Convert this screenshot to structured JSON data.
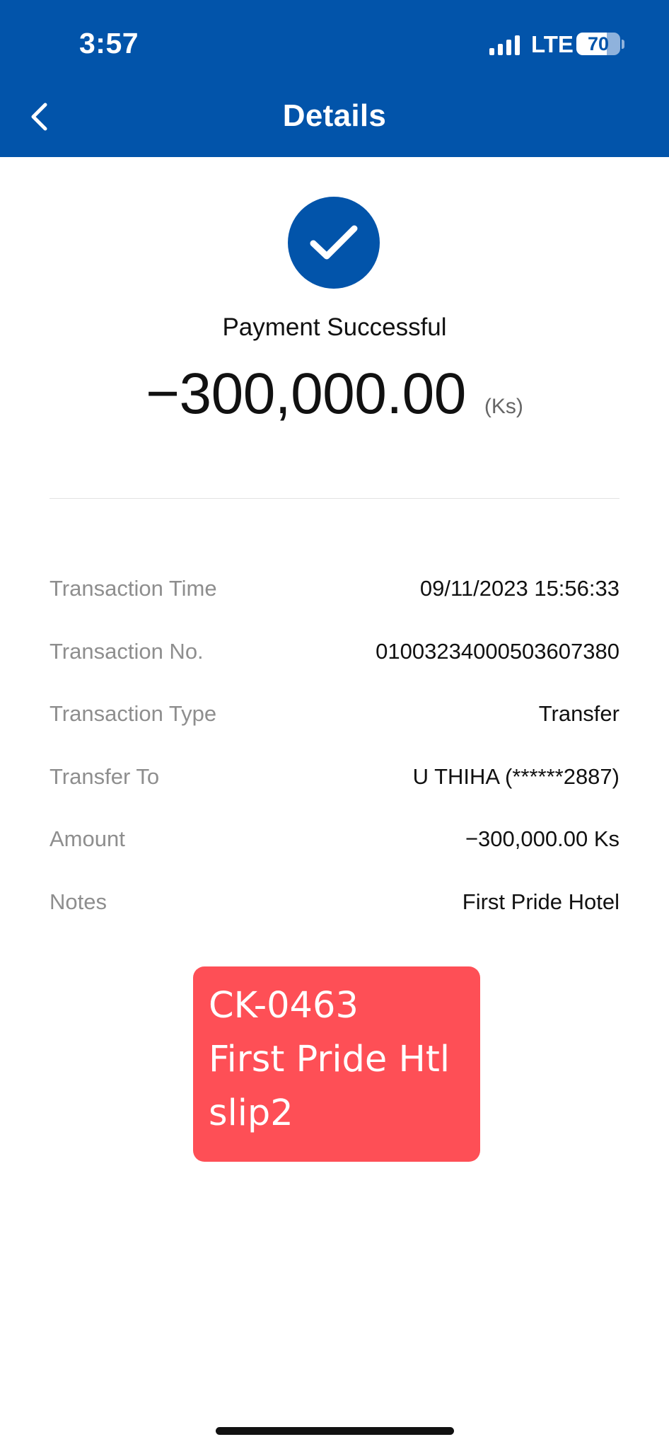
{
  "status_bar": {
    "time": "3:57",
    "network": "LTE",
    "battery_level": "70",
    "battery_fraction": 0.7
  },
  "header": {
    "title": "Details",
    "back_icon": "chevron-left-icon"
  },
  "result": {
    "icon": "check-icon",
    "status": "Payment Successful",
    "amount": "−300,000.00",
    "unit": "(Ks)"
  },
  "details": [
    {
      "label": "Transaction Time",
      "value": "09/11/2023 15:56:33"
    },
    {
      "label": "Transaction No.",
      "value": "01003234000503607380"
    },
    {
      "label": "Transaction Type",
      "value": "Transfer"
    },
    {
      "label": "Transfer To",
      "value": "U THIHA (******2887)"
    },
    {
      "label": "Amount",
      "value": "−300,000.00 Ks"
    },
    {
      "label": "Notes",
      "value": "First Pride Hotel"
    }
  ],
  "sticker": {
    "lines": [
      "CK-0463",
      "First Pride Htl",
      "slip2"
    ]
  },
  "colors": {
    "brand_blue": "#0254aa",
    "sticker_red": "#fe4f56"
  }
}
